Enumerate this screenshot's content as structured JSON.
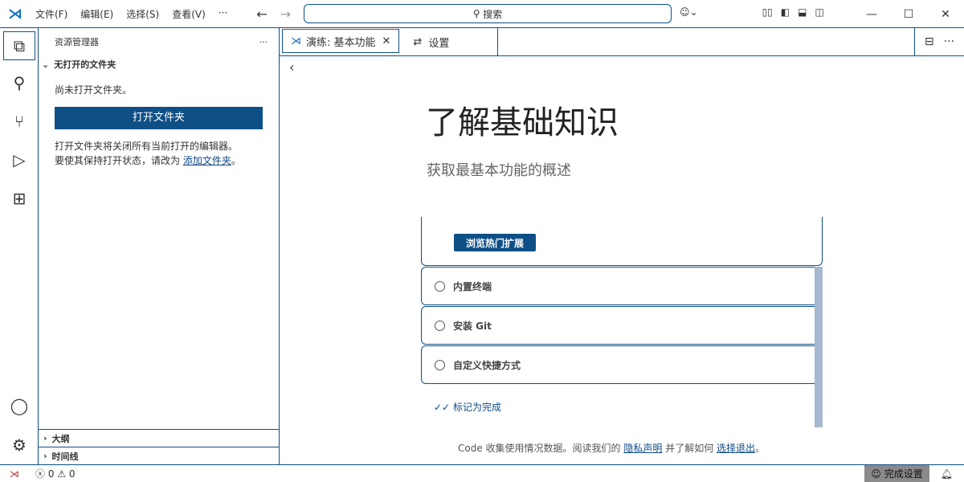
{
  "menu": [
    "文件(F)",
    "编辑(E)",
    "选择(S)",
    "查看(V)",
    "···"
  ],
  "search": {
    "placeholder": "搜索"
  },
  "sidebar": {
    "title": "资源管理器",
    "more": "···",
    "section": "无打开的文件夹",
    "empty": "尚未打开文件夹。",
    "open_button": "打开文件夹",
    "note1": "打开文件夹将关闭所有当前打开的编辑器。",
    "note2": "要使其保持打开状态，请改为 ",
    "note_link": "添加文件夹",
    "note_end": "。",
    "outline": "大纲",
    "timeline": "时间线"
  },
  "tabs": [
    {
      "label": "演练: 基本功能"
    },
    {
      "label": "设置"
    }
  ],
  "editor": {
    "title": "了解基础知识",
    "subtitle": "获取最基本功能的概述",
    "browse_button": "浏览热门扩展",
    "steps": [
      "内置终端",
      "安装 Git",
      "自定义快捷方式"
    ],
    "mark_done": "标记为完成",
    "footer_pre": "Code 收集使用情况数据。阅读我们的 ",
    "privacy": "隐私声明",
    "footer_mid": " 并了解如何 ",
    "opt_out": "选择退出",
    "footer_end": "。"
  },
  "status": {
    "errors": "0",
    "warnings": "0",
    "setup": "完成设置"
  }
}
